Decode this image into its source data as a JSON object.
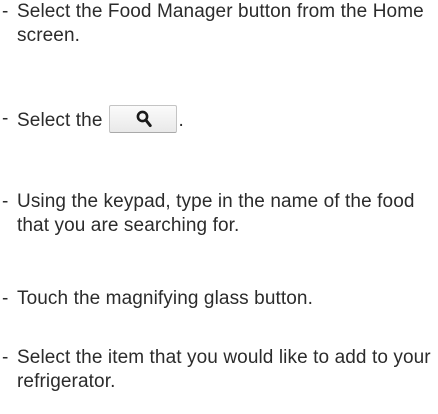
{
  "steps": [
    {
      "dash": "-",
      "text": "Select the Food Manager button from the Home screen."
    },
    {
      "dash": "-",
      "text_before": "Select the",
      "icon": "search-icon",
      "text_after": "."
    },
    {
      "dash": "-",
      "text": "Using the keypad, type in the name of the food that you are searching for."
    },
    {
      "dash": "-",
      "text": "Touch the magnifying glass button."
    },
    {
      "dash": "-",
      "text": "Select the item that you would like to add to your refrigerator."
    }
  ]
}
